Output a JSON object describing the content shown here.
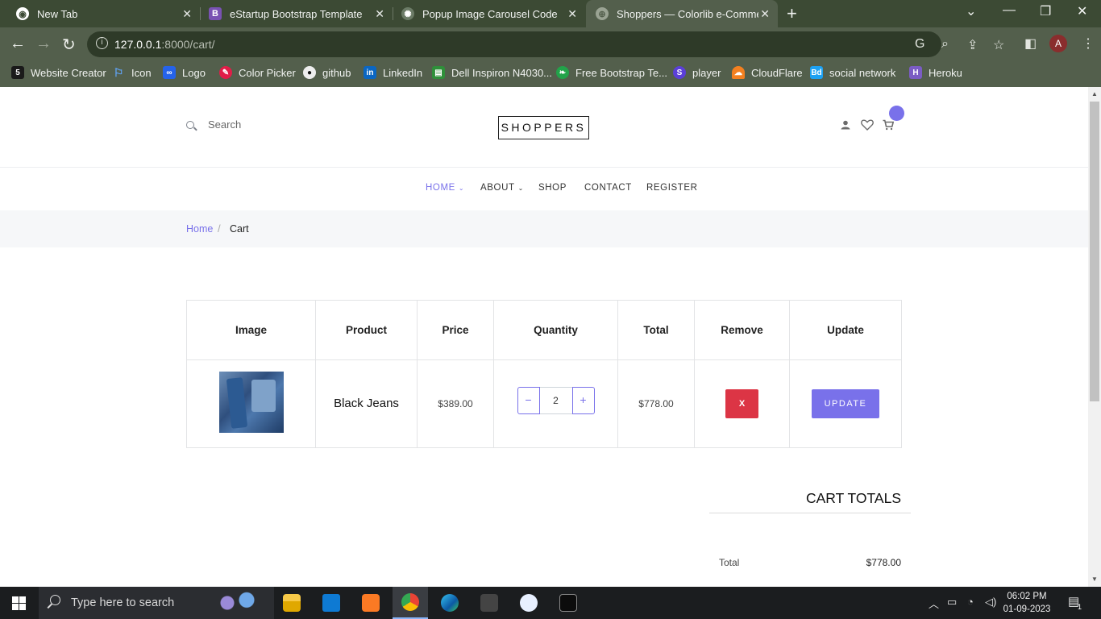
{
  "browser": {
    "tabs": [
      {
        "title": "New Tab",
        "favicon": "chrome-icon",
        "active": false
      },
      {
        "title": "eStartup Bootstrap Template",
        "favicon": "bootstrap-icon",
        "active": false
      },
      {
        "title": "Popup Image Carousel Code",
        "favicon": "openai-icon",
        "active": false
      },
      {
        "title": "Shoppers — Colorlib e-Commerc",
        "favicon": "globe-icon",
        "active": true
      }
    ],
    "url_host": "127.0.0.1",
    "url_rest": ":8000/cart/",
    "profile_initial": "A",
    "bookmarks": [
      {
        "label": "Website Creator",
        "icon": "website-creator-icon",
        "color": "#1a1a1a"
      },
      {
        "label": "Icon",
        "icon": "flag-icon",
        "color": "#3b82f6"
      },
      {
        "label": "Logo",
        "icon": "logo-icon",
        "color": "#2563eb"
      },
      {
        "label": "Color Picker",
        "icon": "color-picker-icon",
        "color": "#e11d48"
      },
      {
        "label": "github",
        "icon": "github-icon",
        "color": "#111111"
      },
      {
        "label": "LinkedIn",
        "icon": "linkedin-icon",
        "color": "#0a66c2"
      },
      {
        "label": "Dell Inspiron N4030...",
        "icon": "dell-icon",
        "color": "#2f8f3a"
      },
      {
        "label": "Free  Bootstrap Te...",
        "icon": "leaf-icon",
        "color": "#22a34a"
      },
      {
        "label": "player",
        "icon": "player-icon",
        "color": "#5b3fd8"
      },
      {
        "label": "CloudFlare",
        "icon": "cloudflare-icon",
        "color": "#f38020"
      },
      {
        "label": "social network",
        "icon": "bd-icon",
        "color": "#1da1f2"
      },
      {
        "label": "Heroku",
        "icon": "heroku-icon",
        "color": "#7b5cc4"
      }
    ]
  },
  "site": {
    "search_placeholder": "Search",
    "logo": "SHOPPERS",
    "nav": [
      {
        "label": "HOME",
        "dropdown": true,
        "active": true
      },
      {
        "label": "ABOUT",
        "dropdown": true,
        "active": false
      },
      {
        "label": "SHOP",
        "dropdown": false,
        "active": false
      },
      {
        "label": "CONTACT",
        "dropdown": false,
        "active": false
      },
      {
        "label": "REGISTER",
        "dropdown": false,
        "active": false
      }
    ],
    "breadcrumb": {
      "home": "Home",
      "separator": "/",
      "current": "Cart"
    },
    "accent_color": "#7971ea"
  },
  "cart": {
    "headers": [
      "Image",
      "Product",
      "Price",
      "Quantity",
      "Total",
      "Remove",
      "Update"
    ],
    "rows": [
      {
        "product": "Black Jeans",
        "price": "$389.00",
        "quantity": "2",
        "total": "$778.00",
        "remove_label": "X",
        "update_label": "UPDATE"
      }
    ],
    "qty_minus": "−",
    "qty_plus": "+",
    "totals_title": "CART TOTALS",
    "totals_label": "Total",
    "totals_value": "$778.00"
  },
  "taskbar": {
    "search_placeholder": "Type here to search",
    "time": "06:02 PM",
    "date": "01-09-2023",
    "notification_count": "1"
  }
}
